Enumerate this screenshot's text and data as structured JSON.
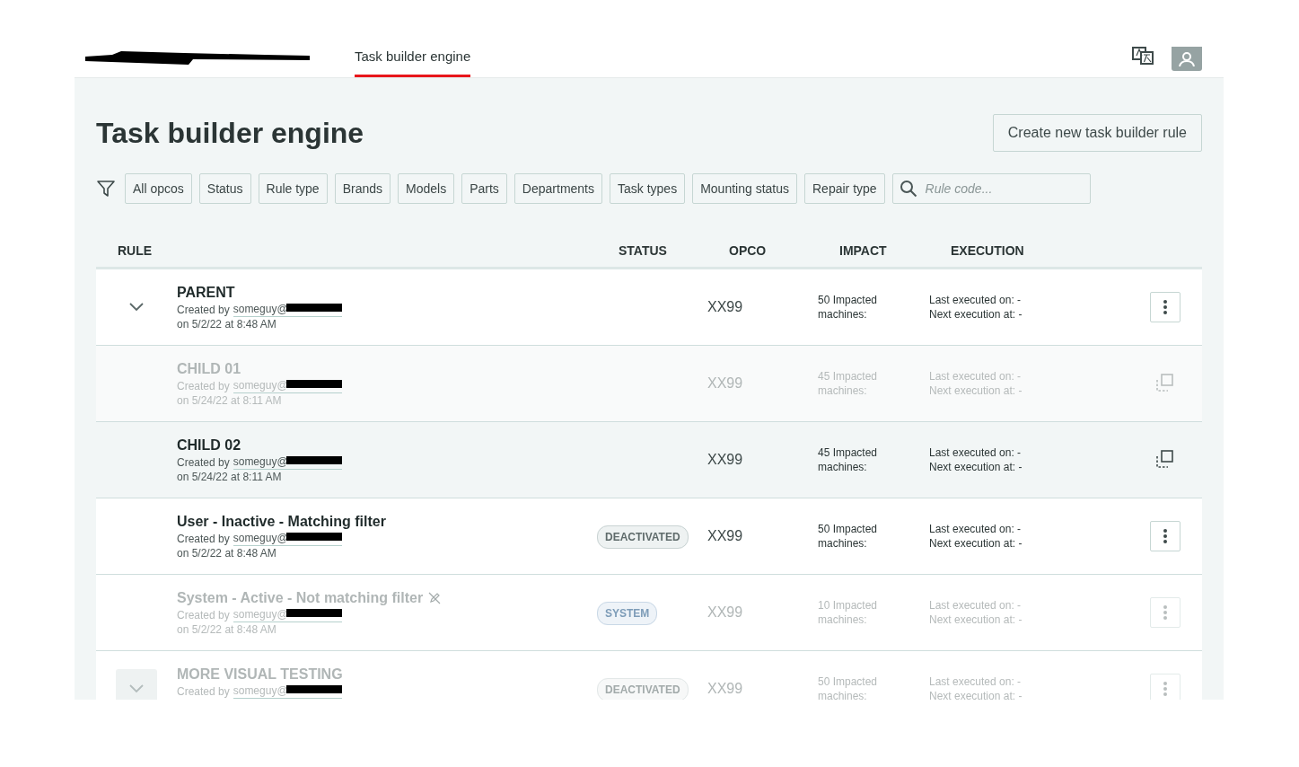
{
  "header": {
    "tabs": [
      {
        "label": "Task builder engine",
        "selected": true
      }
    ]
  },
  "page": {
    "title": "Task builder engine",
    "create_button": "Create new task builder rule"
  },
  "filters": {
    "chips": [
      "All opcos",
      "Status",
      "Rule type",
      "Brands",
      "Models",
      "Parts",
      "Departments",
      "Task types",
      "Mounting status",
      "Repair type"
    ],
    "search": {
      "placeholder": "Rule code..."
    }
  },
  "table": {
    "columns": [
      "RULE",
      "STATUS",
      "OPCO",
      "IMPACT",
      "EXECUTION"
    ],
    "rows": [
      {
        "kind": "parent",
        "name": "PARENT",
        "created_by": "Created by",
        "email": "someguy@",
        "date": "on 5/2/22 at 8:48 AM",
        "opco": "XX99",
        "impact": "50 Impacted machines:",
        "last_executed": "Last executed on: -",
        "next_execution": "Next execution at: -",
        "has_menu": true,
        "disabled": false,
        "highlighted": false,
        "expanded": true,
        "children": [
          {
            "kind": "child",
            "name": "CHILD 01",
            "created_by": "Created by",
            "email": "someguy@",
            "date": "on 5/24/22 at 8:11 AM",
            "opco": "XX99",
            "impact": "45 Impacted machines:",
            "last_executed": "Last executed on: -",
            "next_execution": "Next execution at: -",
            "has_menu": false,
            "disabled": true,
            "highlighted": false
          },
          {
            "kind": "child",
            "name": "CHILD 02",
            "created_by": "Created by",
            "email": "someguy@",
            "date": "on 5/24/22 at 8:11 AM",
            "opco": "XX99",
            "impact": "45 Impacted machines:",
            "last_executed": "Last executed on: -",
            "next_execution": "Next execution at: -",
            "has_menu": false,
            "disabled": false,
            "highlighted": true
          }
        ]
      },
      {
        "kind": "rule",
        "name": "User - Inactive - Matching filter",
        "created_by": "Created by",
        "email": "someguy@",
        "date": "on 5/2/22 at 8:48 AM",
        "status": {
          "label": "DEACTIVATED",
          "kind": "deactivated"
        },
        "opco": "XX99",
        "impact": "50 Impacted machines:",
        "last_executed": "Last executed on: -",
        "next_execution": "Next execution at: -",
        "has_menu": true,
        "disabled": false,
        "highlighted": false
      },
      {
        "kind": "rule",
        "name": "System - Active - Not matching filter",
        "edit_locked": true,
        "created_by": "Created by",
        "email": "someguy@",
        "date": "on 5/2/22 at 8:48 AM",
        "status": {
          "label": "SYSTEM",
          "kind": "system"
        },
        "opco": "XX99",
        "impact": "10 Impacted machines:",
        "last_executed": "Last executed on: -",
        "next_execution": "Next execution at: -",
        "has_menu": true,
        "disabled": true,
        "highlighted": false
      },
      {
        "kind": "parent",
        "name": "MORE VISUAL TESTING",
        "created_by": "Created by",
        "email": "someguy@",
        "status": {
          "label": "DEACTIVATED",
          "kind": "deactivated"
        },
        "opco": "XX99",
        "impact": "50 Impacted machines:",
        "last_executed": "Last executed on: -",
        "next_execution": "Next execution at: -",
        "has_menu": true,
        "disabled": true,
        "highlighted": false,
        "expanded": false
      }
    ]
  }
}
